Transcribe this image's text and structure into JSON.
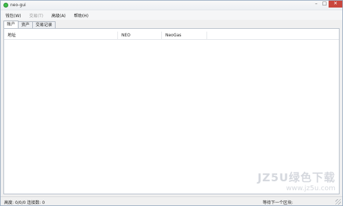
{
  "window": {
    "title": "neo-gui",
    "controls": {
      "minimize": "–",
      "maximize": "□",
      "close": "✕"
    }
  },
  "menu": [
    {
      "label": "钱包(W)",
      "disabled": false
    },
    {
      "label": "交易(T)",
      "disabled": true
    },
    {
      "label": "高级(A)",
      "disabled": false
    },
    {
      "label": "帮助(H)",
      "disabled": false
    }
  ],
  "tabs": [
    {
      "label": "账户",
      "active": true
    },
    {
      "label": "资产",
      "active": false
    },
    {
      "label": "交易记录",
      "active": false
    }
  ],
  "accounts_table": {
    "columns": [
      "地址",
      "NEO",
      "NeoGas"
    ],
    "rows": []
  },
  "watermark": {
    "main": "JZ5U绿色下载",
    "sub": "www.jz5u.com"
  },
  "status": {
    "height_label": "高度:",
    "height_value": "0/0/0",
    "connections_label": "连接数:",
    "connections_value": "0",
    "right_text": "等待下一个区块:"
  }
}
